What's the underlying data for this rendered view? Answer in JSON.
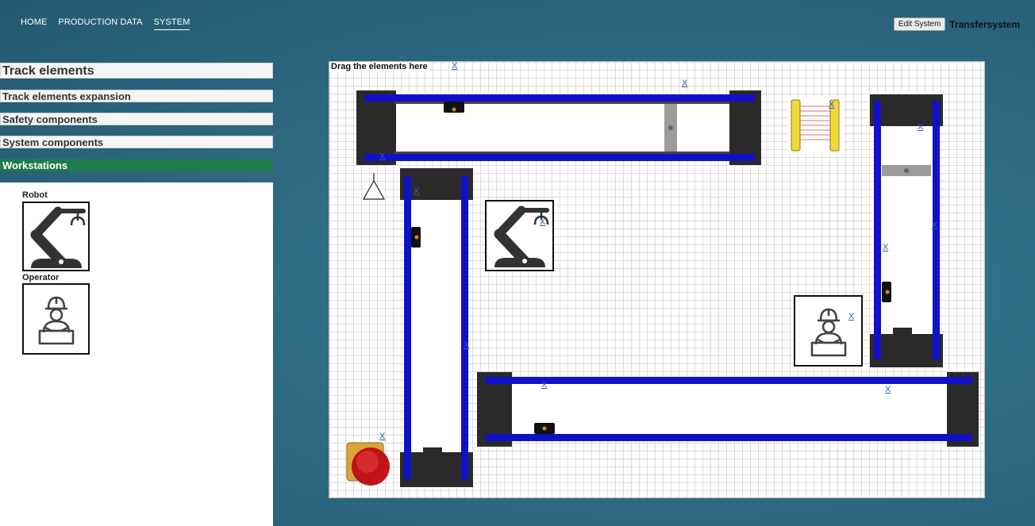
{
  "nav": {
    "items": [
      {
        "label": "HOME"
      },
      {
        "label": "PRODUCTION DATA"
      },
      {
        "label": "SYSTEM"
      }
    ]
  },
  "header": {
    "edit_button": "Edit System",
    "title": "Transfersystem"
  },
  "sidebar": {
    "sections": [
      {
        "label": "Track elements"
      },
      {
        "label": "Track elements expansion"
      },
      {
        "label": "Safety components"
      },
      {
        "label": "System components"
      },
      {
        "label": "Workstations"
      }
    ],
    "tools": [
      {
        "label": "Robot",
        "icon": "robot-arm-icon"
      },
      {
        "label": "Operator",
        "icon": "operator-icon"
      }
    ]
  },
  "canvas": {
    "drop_hint": "Drag the elements here",
    "remove_label": "X"
  },
  "colors": {
    "accent_active": "#1f7a4c",
    "conveyor_belt": "#1010c8",
    "link": "#2c5fb8"
  }
}
